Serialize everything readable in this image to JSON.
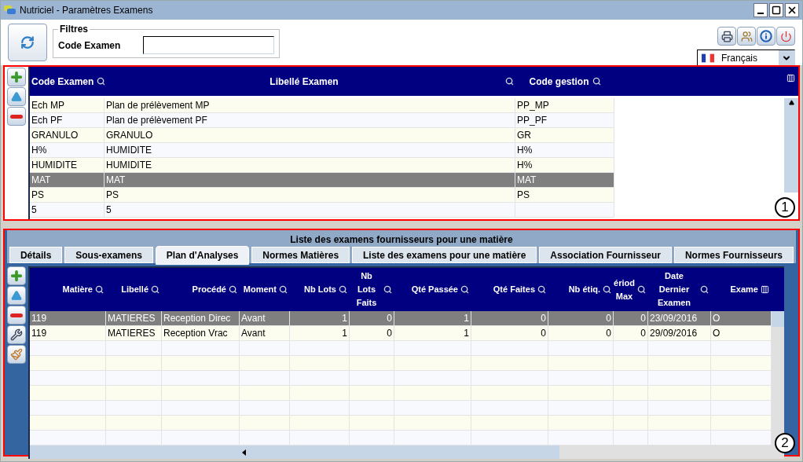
{
  "window": {
    "title": "Nutriciel - Paramètres Examens"
  },
  "filters": {
    "legend": "Filtres",
    "label": "Code Examen"
  },
  "language": {
    "value": "Français"
  },
  "examens": {
    "columns": [
      "Code Examen",
      "Libellé Examen",
      "Code gestion"
    ],
    "rows": [
      {
        "cells": [
          "Ech MP",
          "Plan de prélèvement MP",
          "PP_MP"
        ],
        "selected": false
      },
      {
        "cells": [
          "Ech PF",
          "Plan de prélèvement PF",
          "PP_PF"
        ],
        "selected": false
      },
      {
        "cells": [
          "GRANULO",
          "GRANULO",
          "GR"
        ],
        "selected": false
      },
      {
        "cells": [
          "H%",
          "HUMIDITE",
          "H%"
        ],
        "selected": false
      },
      {
        "cells": [
          "HUMIDITE",
          "HUMIDITE",
          "H%"
        ],
        "selected": false
      },
      {
        "cells": [
          "MAT",
          "MAT",
          "MAT"
        ],
        "selected": true
      },
      {
        "cells": [
          "PS",
          "PS",
          "PS"
        ],
        "selected": false
      },
      {
        "cells": [
          "5",
          "5",
          ""
        ],
        "selected": false
      }
    ],
    "callout": "1"
  },
  "fournisseurs": {
    "title": "Liste des examens fournisseurs pour une matière",
    "tabs": [
      {
        "label": "Détails",
        "selected": false
      },
      {
        "label": "Sous-examens",
        "selected": false
      },
      {
        "label": "Plan d'Analyses",
        "selected": true
      },
      {
        "label": "Normes Matières",
        "selected": false
      },
      {
        "label": "Liste des examens pour une matière",
        "selected": false
      },
      {
        "label": "Association Fournisseur",
        "selected": false
      },
      {
        "label": "Normes Fournisseurs",
        "selected": false
      }
    ],
    "columns": [
      "Matière",
      "Libellé",
      "Procédé",
      "Moment",
      "Nb Lots",
      "Nb Lots Faits",
      "Qté Passée",
      "Qté Faites",
      "Nb étiq.",
      "ériod Max",
      "Date Dernier Examen",
      "Exame"
    ],
    "rows": [
      {
        "cells": [
          "119",
          "MATIERES",
          "Reception Direc",
          "Avant",
          "1",
          "0",
          "1",
          "0",
          "0",
          "0",
          "23/09/2016",
          "O"
        ],
        "selected": true
      },
      {
        "cells": [
          "119",
          "MATIERES",
          "Reception Vrac",
          "Avant",
          "1",
          "0",
          "1",
          "0",
          "0",
          "0",
          "29/09/2016",
          "O"
        ],
        "selected": false
      }
    ],
    "callout": "2"
  }
}
